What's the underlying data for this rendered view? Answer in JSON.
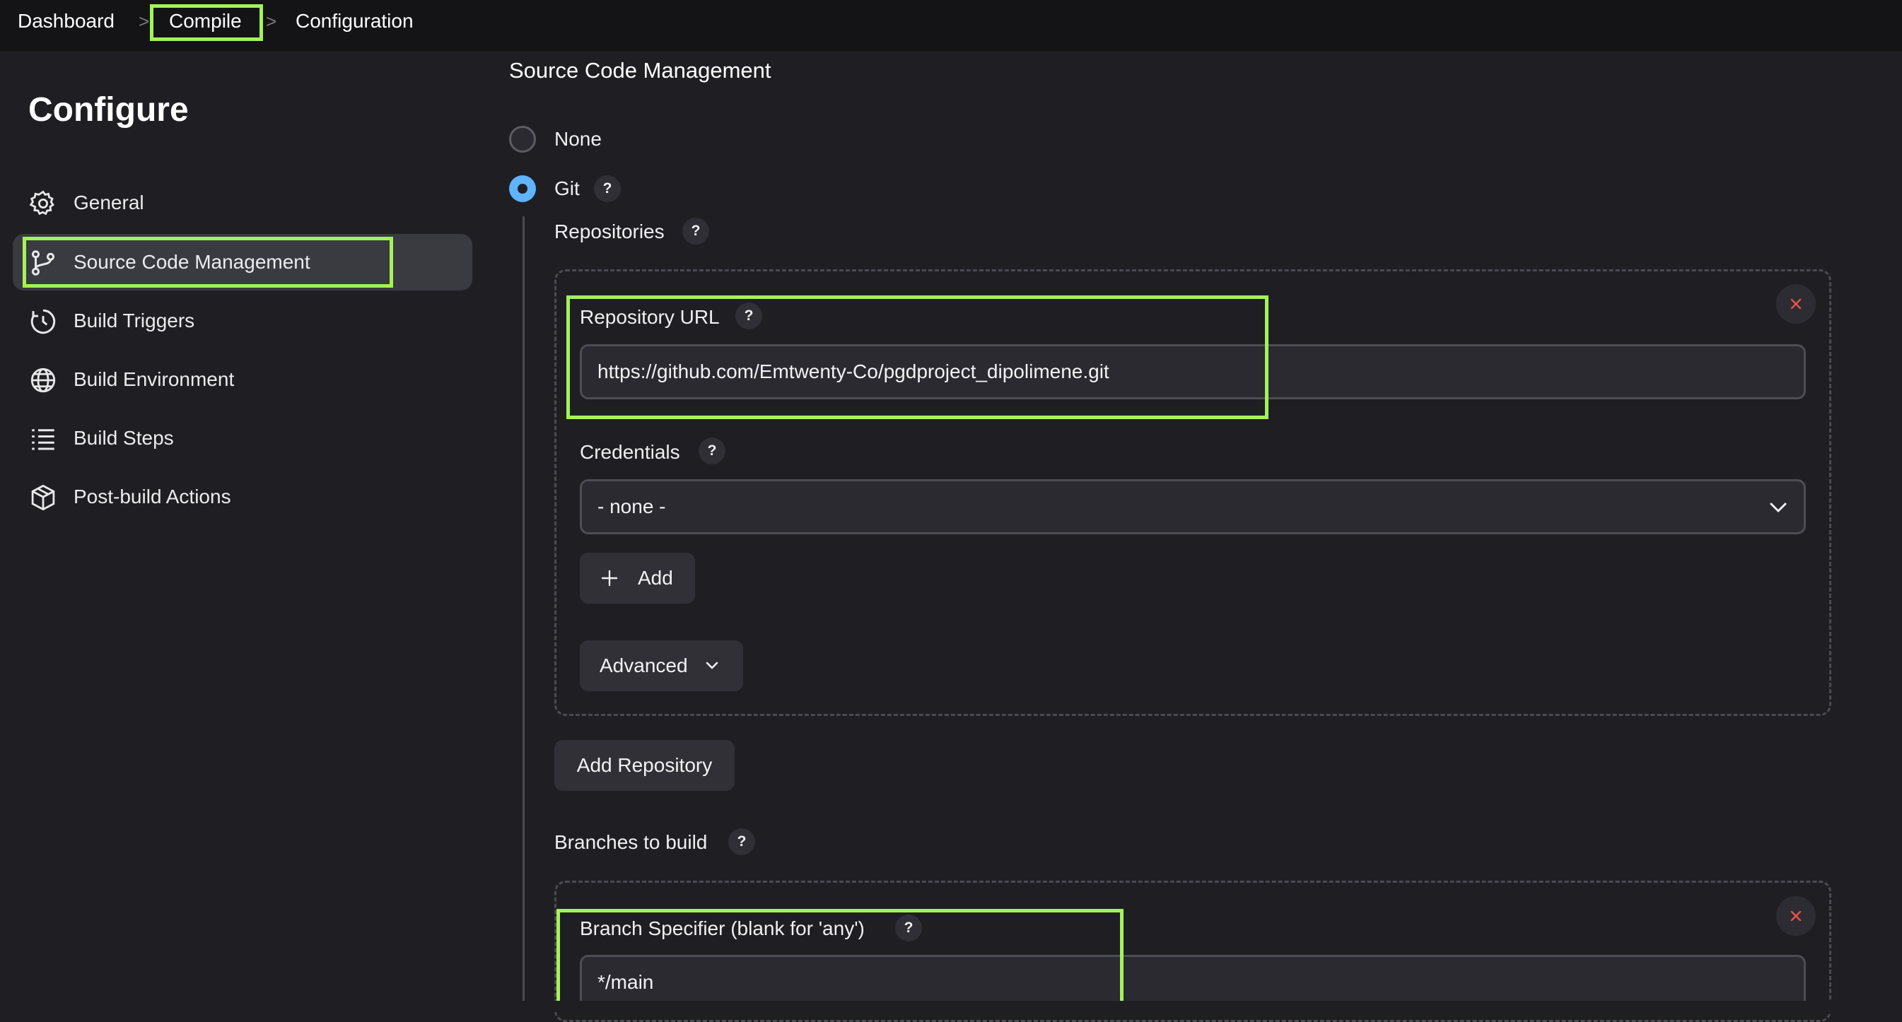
{
  "breadcrumb": {
    "items": [
      "Dashboard",
      "Compile",
      "Configuration"
    ],
    "separator": ">"
  },
  "sidebar": {
    "title": "Configure",
    "items": [
      {
        "label": "General",
        "icon": "gear-icon"
      },
      {
        "label": "Source Code Management",
        "icon": "git-branch-icon",
        "active": true
      },
      {
        "label": "Build Triggers",
        "icon": "clock-icon"
      },
      {
        "label": "Build Environment",
        "icon": "globe-icon"
      },
      {
        "label": "Build Steps",
        "icon": "list-icon"
      },
      {
        "label": "Post-build Actions",
        "icon": "package-icon"
      }
    ]
  },
  "main": {
    "section_title": "Source Code Management",
    "scm_options": [
      {
        "label": "None",
        "selected": false
      },
      {
        "label": "Git",
        "selected": true
      }
    ],
    "help_label": "?",
    "repositories": {
      "label": "Repositories",
      "repository_url_label": "Repository URL",
      "repository_url_value": "https://github.com/Emtwenty-Co/pgdproject_dipolimene.git",
      "credentials_label": "Credentials",
      "credentials_value": "- none -",
      "add_label": "Add",
      "advanced_label": "Advanced",
      "add_repository_label": "Add Repository"
    },
    "branches": {
      "label": "Branches to build",
      "branch_specifier_label": "Branch Specifier (blank for 'any')",
      "branch_specifier_value": "*/main"
    }
  },
  "colors": {
    "highlight": "#a3f25a",
    "radio_selected": "#5fb3ff",
    "delete_x": "#e5534b"
  }
}
